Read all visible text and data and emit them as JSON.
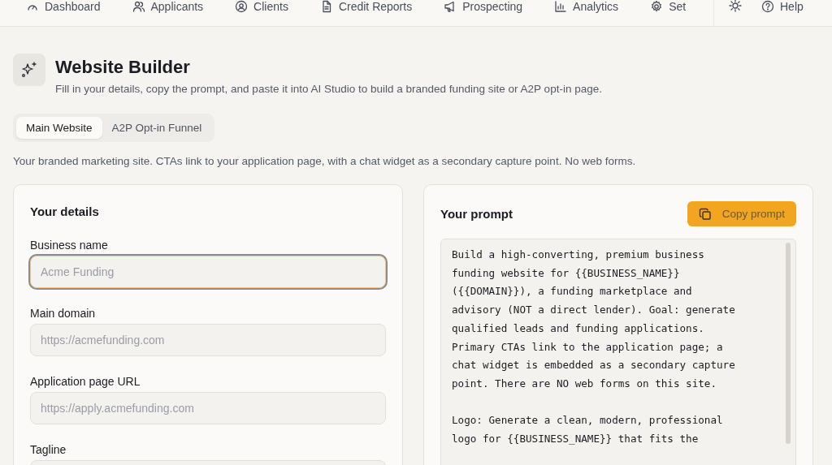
{
  "nav": {
    "items": [
      {
        "label": "Dashboard"
      },
      {
        "label": "Applicants"
      },
      {
        "label": "Clients"
      },
      {
        "label": "Credit Reports"
      },
      {
        "label": "Prospecting"
      },
      {
        "label": "Analytics"
      },
      {
        "label": "Set"
      }
    ],
    "help": "Help"
  },
  "header": {
    "title": "Website Builder",
    "subtitle": "Fill in your details, copy the prompt, and paste it into AI Studio to build a branded funding site or A2P opt-in page."
  },
  "tabs": [
    {
      "label": "Main Website",
      "selected": true
    },
    {
      "label": "A2P Opt-in Funnel",
      "selected": false
    }
  ],
  "description": "Your branded marketing site. CTAs link to your application page, with a chat widget as a secondary capture point. No web forms.",
  "details": {
    "title": "Your details",
    "fields": [
      {
        "label": "Business name",
        "placeholder": "Acme Funding",
        "focused": true
      },
      {
        "label": "Main domain",
        "placeholder": "https://acmefunding.com",
        "focused": false
      },
      {
        "label": "Application page URL",
        "placeholder": "https://apply.acmefunding.com",
        "focused": false
      },
      {
        "label": "Tagline",
        "focused": false
      }
    ]
  },
  "prompt": {
    "title": "Your prompt",
    "copy_button": "Copy prompt",
    "paragraphs": [
      [
        "Build a high-converting, premium business",
        "funding website for {{BUSINESS_NAME}}",
        "({{DOMAIN}}), a funding marketplace and",
        "advisory (NOT a direct lender). Goal: generate",
        "qualified leads and funding applications.",
        "Primary CTAs link to the application page; a",
        "chat widget is embedded as a secondary capture",
        "point. There are NO web forms on this site."
      ],
      [
        "Logo: Generate a clean, modern, professional",
        "logo for {{BUSINESS_NAME}} that fits the"
      ]
    ]
  }
}
